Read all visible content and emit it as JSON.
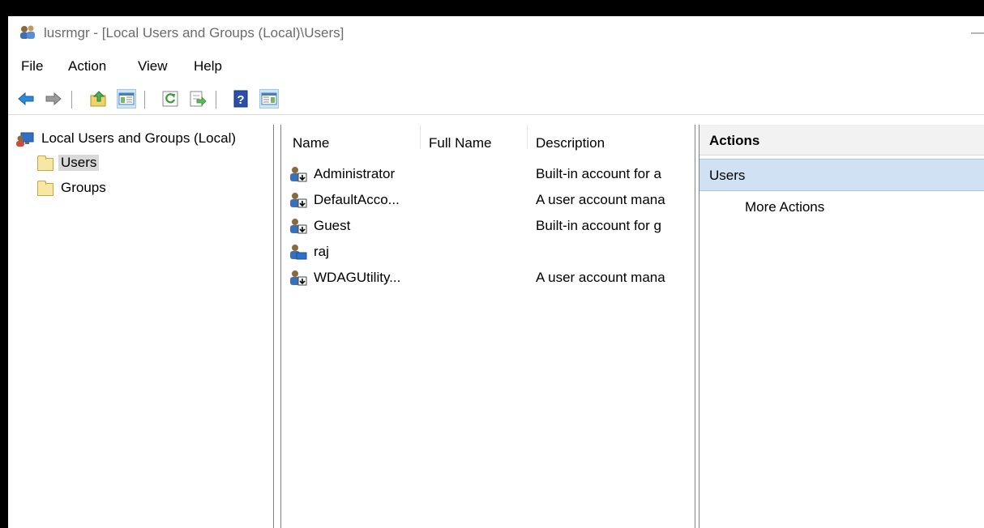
{
  "window": {
    "title": "lusrmgr - [Local Users and Groups (Local)\\Users]",
    "minimize_glyph": "—"
  },
  "menu": [
    "File",
    "Action",
    "View",
    "Help"
  ],
  "toolbar": {
    "buttons": [
      "back-icon",
      "forward-icon",
      "up-folder-icon",
      "show-hide-tree-icon",
      "refresh-icon",
      "export-list-icon",
      "help-icon",
      "show-hide-action-pane-icon"
    ]
  },
  "tree": {
    "root": "Local Users and Groups (Local)",
    "children": [
      "Users",
      "Groups"
    ]
  },
  "list": {
    "columns": [
      "Name",
      "Full Name",
      "Description"
    ],
    "rows": [
      {
        "name": "Administrator",
        "full_name": "",
        "description": "Built-in account for a"
      },
      {
        "name": "DefaultAcco...",
        "full_name": "",
        "description": "A user account mana"
      },
      {
        "name": "Guest",
        "full_name": "",
        "description": "Built-in account for g"
      },
      {
        "name": "raj",
        "full_name": "",
        "description": ""
      },
      {
        "name": "WDAGUtility...",
        "full_name": "",
        "description": "A user account mana"
      }
    ]
  },
  "actions": {
    "header": "Actions",
    "section": "Users",
    "more": "More Actions"
  },
  "colors": {
    "selection_gray": "#d9d9d9",
    "actions_section_bg": "#cfe1f3",
    "pressed_button_bg": "#cfe6f8"
  }
}
